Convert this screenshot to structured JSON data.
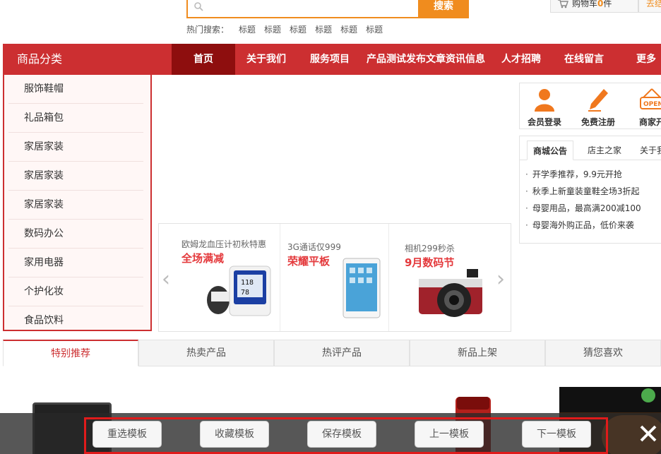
{
  "header": {
    "search": {
      "button_label": "搜索",
      "placeholder": ""
    },
    "hot_search": {
      "label": "热门搜索：",
      "items": [
        "标题",
        "标题",
        "标题",
        "标题",
        "标题",
        "标题"
      ]
    },
    "cart": {
      "label_prefix": "购物车",
      "count": "0",
      "label_suffix": "件"
    },
    "checkout_label": "去结"
  },
  "nav": {
    "category_title": "商品分类",
    "items": [
      "首页",
      "关于我们",
      "服务项目",
      "产品测试发布文章资讯信息",
      "人才招聘",
      "在线留言",
      "更多"
    ]
  },
  "sidebar": {
    "categories": [
      "服饰鞋帽",
      "礼品箱包",
      "家居家装",
      "家居家装",
      "家居家装",
      "数码办公",
      "家用电器",
      "个护化妆",
      "食品饮料"
    ]
  },
  "promos": [
    {
      "subtitle": "欧姆龙血压计初秋特惠",
      "headline": "全场满减"
    },
    {
      "subtitle": "3G通话仅999",
      "headline": "荣耀平板"
    },
    {
      "subtitle": "相机299秒杀",
      "headline": "9月数码节"
    }
  ],
  "member_links": [
    {
      "label": "会员登录",
      "icon": "user-icon"
    },
    {
      "label": "免费注册",
      "icon": "pen-icon"
    },
    {
      "label": "商家开",
      "icon": "open-sign-icon"
    }
  ],
  "notice": {
    "tabs": [
      "商城公告",
      "店主之家",
      "关于我"
    ],
    "items": [
      "开学季推荐，9.9元开抢",
      "秋季上新童装童鞋全场3折起",
      "母婴用品，最高满200减100",
      "母婴海外购正品，低价来袭"
    ]
  },
  "product_tabs": [
    "特别推荐",
    "热卖产品",
    "热评产品",
    "新品上架",
    "猜您喜欢"
  ],
  "template_toolbar": {
    "buttons": [
      "重选模板",
      "收藏模板",
      "保存模板",
      "上一模板",
      "下一模板"
    ],
    "close_icon": "close-icon"
  },
  "colors": {
    "accent_orange": "#f08c1e",
    "nav_red": "#cc2f31",
    "nav_active": "#8e0e0e",
    "highlight_red": "#e4393c"
  }
}
